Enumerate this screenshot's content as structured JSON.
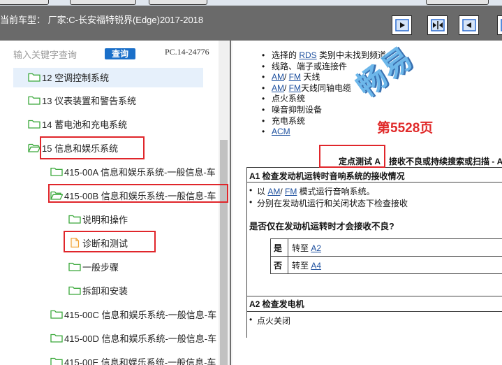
{
  "header": {
    "vehicle_label": "当前车型： 厂家:C-长安福特锐界(Edge)2017-2018",
    "icon_buttons": [
      "next-page-icon",
      "split-view-icon",
      "previous-page-icon"
    ]
  },
  "search": {
    "placeholder": "输入关键字查询",
    "button_label": "查询",
    "code": "PC.14-24776"
  },
  "tree": {
    "items": [
      {
        "label": "12 空调控制系统",
        "icon": "folder-icon",
        "selected": true
      },
      {
        "label": "13 仪表装置和警告系统",
        "icon": "folder-icon"
      },
      {
        "label": "14 蓄电池和充电系统",
        "icon": "folder-icon"
      },
      {
        "label": "15 信息和娱乐系统",
        "icon": "folder-open-icon",
        "marked": true
      },
      {
        "label": "415-00A 信息和娱乐系统-一般信息-车",
        "icon": "folder-icon"
      },
      {
        "label": "415-00B 信息和娱乐系统-一般信息-车",
        "icon": "folder-open-icon",
        "marked": true
      },
      {
        "label": "说明和操作",
        "icon": "folder-icon"
      },
      {
        "label": "诊断和测试",
        "icon": "document-icon",
        "marked": true
      },
      {
        "label": "一般步骤",
        "icon": "folder-icon"
      },
      {
        "label": "拆卸和安装",
        "icon": "folder-icon"
      },
      {
        "label": "415-00C 信息和娱乐系统-一般信息-车",
        "icon": "folder-icon"
      },
      {
        "label": "415-00D 信息和娱乐系统-一般信息-车",
        "icon": "folder-icon"
      },
      {
        "label": "415-00E 信息和娱乐系统-一般信息-车",
        "icon": "folder-icon"
      }
    ]
  },
  "content": {
    "watermark": "畅易",
    "page_stamp": "第5528页",
    "causes": {
      "rds": {
        "pre": "选择的 ",
        "link": "RDS",
        "post": " 类别中未找到频道"
      },
      "wiring": "线路、端子或连接件",
      "antenna": {
        "am": "AM",
        "sep": "/ ",
        "fm": "FM",
        "post": " 天线"
      },
      "coax": {
        "am": "AM",
        "sep": "/ ",
        "fm": "FM",
        "post": "天线同轴电缆"
      },
      "ignition": "点火系统",
      "noise": "噪音抑制设备",
      "charging": "充电系统",
      "acm": "ACM"
    },
    "test": {
      "title": "定点测试 A",
      "subtitle": "接收不良或持续搜索或扫描 - A"
    },
    "a1": {
      "title": "A1 检查发动机运转时音响系统的接收情况",
      "step1": {
        "pre": "以 ",
        "am": "AM",
        "sep": "/ ",
        "fm": "FM",
        "post": " 模式运行音响系统。"
      },
      "step2": "分别在发动机运行和关闭状态下检查接收",
      "question": "是否仅在发动机运转时才会接收不良?",
      "answers": [
        {
          "answer": "是",
          "action": "转至 ",
          "target": "A2"
        },
        {
          "answer": "否",
          "action": "转至 ",
          "target": "A4"
        }
      ]
    },
    "a2": {
      "title": "A2 检查发电机",
      "step1": "点火关闭"
    }
  },
  "colors": {
    "header_bg": "#6a6a6a",
    "accent": "#1a6fc9",
    "marker": "#e0262b",
    "link": "#1c4f9e",
    "folder": "#3aa83a",
    "document": "#f0a030",
    "page_stamp": "#e02a2a",
    "selection": "#e6f0fb"
  }
}
